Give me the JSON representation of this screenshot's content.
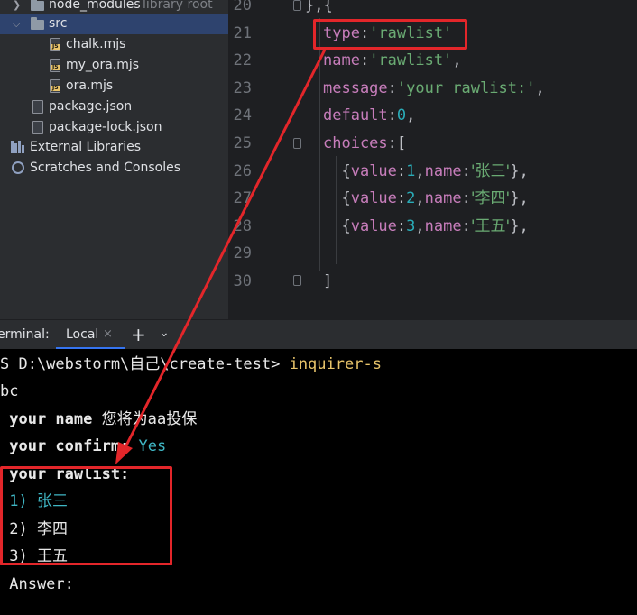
{
  "project_tree": {
    "items": [
      {
        "label": "node_modules",
        "suffix": "library root"
      },
      {
        "label": "src"
      },
      {
        "label": "chalk.mjs"
      },
      {
        "label": "my_ora.mjs"
      },
      {
        "label": "ora.mjs"
      },
      {
        "label": "package.json"
      },
      {
        "label": "package-lock.json"
      },
      {
        "label": "External Libraries"
      },
      {
        "label": "Scratches and Consoles"
      }
    ],
    "file_badge": "JS"
  },
  "editor": {
    "line_numbers": [
      "20",
      "21",
      "22",
      "23",
      "24",
      "25",
      "26",
      "27",
      "28",
      "29",
      "30"
    ],
    "lines": [
      [
        {
          "t": "},{",
          "c": "p"
        }
      ],
      [
        {
          "t": "type",
          "c": "k"
        },
        {
          "t": ":",
          "c": "p"
        },
        {
          "t": "'rawlist'",
          "c": "s"
        }
      ],
      [
        {
          "t": "name",
          "c": "k"
        },
        {
          "t": ":",
          "c": "p"
        },
        {
          "t": "'rawlist'",
          "c": "s"
        },
        {
          "t": ",",
          "c": "p"
        }
      ],
      [
        {
          "t": "message",
          "c": "k"
        },
        {
          "t": ":",
          "c": "p"
        },
        {
          "t": "'your rawlist:'",
          "c": "s"
        },
        {
          "t": ",",
          "c": "p"
        }
      ],
      [
        {
          "t": "default",
          "c": "k"
        },
        {
          "t": ":",
          "c": "p"
        },
        {
          "t": "0",
          "c": "n"
        },
        {
          "t": ",",
          "c": "p"
        }
      ],
      [
        {
          "t": "choices",
          "c": "k"
        },
        {
          "t": ":[",
          "c": "p"
        }
      ],
      [
        {
          "t": "  {",
          "c": "p"
        },
        {
          "t": "value",
          "c": "k"
        },
        {
          "t": ":",
          "c": "p"
        },
        {
          "t": "1",
          "c": "n"
        },
        {
          "t": ",",
          "c": "p"
        },
        {
          "t": "name",
          "c": "k"
        },
        {
          "t": ":",
          "c": "p"
        },
        {
          "t": "'张三'",
          "c": "s cn"
        },
        {
          "t": "},",
          "c": "p"
        }
      ],
      [
        {
          "t": "  {",
          "c": "p"
        },
        {
          "t": "value",
          "c": "k"
        },
        {
          "t": ":",
          "c": "p"
        },
        {
          "t": "2",
          "c": "n"
        },
        {
          "t": ",",
          "c": "p"
        },
        {
          "t": "name",
          "c": "k"
        },
        {
          "t": ":",
          "c": "p"
        },
        {
          "t": "'李四'",
          "c": "s cn"
        },
        {
          "t": "},",
          "c": "p"
        }
      ],
      [
        {
          "t": "  {",
          "c": "p"
        },
        {
          "t": "value",
          "c": "k"
        },
        {
          "t": ":",
          "c": "p"
        },
        {
          "t": "3",
          "c": "n"
        },
        {
          "t": ",",
          "c": "p"
        },
        {
          "t": "name",
          "c": "k"
        },
        {
          "t": ":",
          "c": "p"
        },
        {
          "t": "'王五'",
          "c": "s cn"
        },
        {
          "t": "},",
          "c": "p"
        }
      ],
      [],
      [
        {
          "t": "]",
          "c": "p"
        }
      ]
    ]
  },
  "terminal_tabs": {
    "label": "erminal:",
    "active_tab": "Local",
    "close_glyph": "×",
    "add_glyph": "+",
    "menu_glyph": "⌄"
  },
  "terminal": {
    "prompt": "S D:\\webstorm\\自己\\create-test> ",
    "command": "inquirer-s",
    "wrap": "bc",
    "q1_label": " your name ",
    "q1_answer": "您将为aa投保",
    "q2_label": " your confirm: ",
    "q2_answer": "Yes",
    "q3_label": " your rawlist:",
    "choice1": " 1) 张三",
    "choice2": " 2) 李四",
    "choice3": " 3) 王五",
    "answer_label": " Answer:"
  },
  "colors": {
    "annotation": "#e3262a",
    "keyword": "#c77dbb",
    "string": "#6aab73",
    "number": "#2aacb8",
    "selected_choice": "#3fb6c4",
    "tab_underline": "#3574f0"
  }
}
